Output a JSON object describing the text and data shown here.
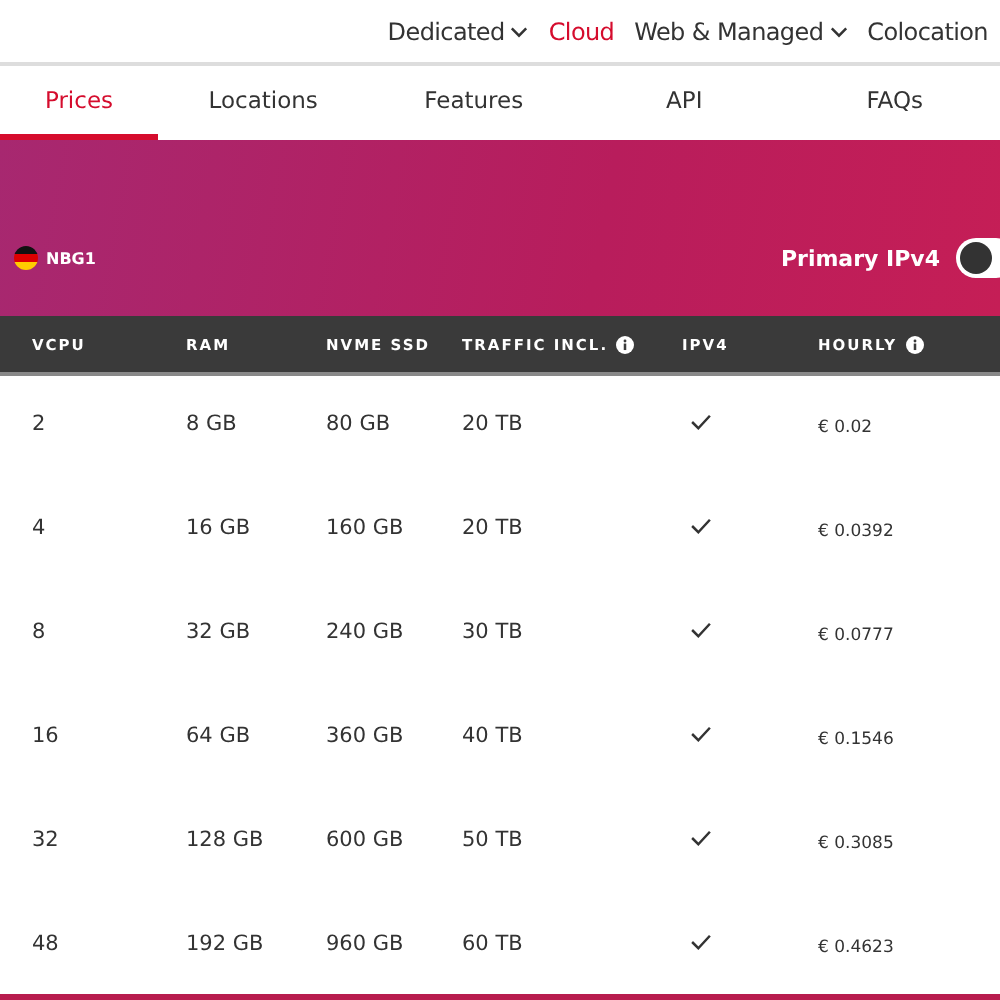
{
  "nav": [
    {
      "label": "Dedicated",
      "dropdown": true,
      "selected": false
    },
    {
      "label": "Cloud",
      "dropdown": false,
      "selected": true
    },
    {
      "label": "Web & Managed",
      "dropdown": true,
      "selected": false
    },
    {
      "label": "Colocation",
      "dropdown": false,
      "selected": false
    }
  ],
  "tabs": [
    {
      "label": "Prices",
      "selected": true
    },
    {
      "label": "Locations",
      "selected": false
    },
    {
      "label": "Features",
      "selected": false
    },
    {
      "label": "API",
      "selected": false
    },
    {
      "label": "FAQs",
      "selected": false
    }
  ],
  "location": {
    "label": "NBG1"
  },
  "ipv4_toggle": {
    "label": "Primary IPv4",
    "on": false
  },
  "table": {
    "columns": [
      {
        "label": "VCPU",
        "info": false
      },
      {
        "label": "RAM",
        "info": false
      },
      {
        "label": "NVME SSD",
        "info": false
      },
      {
        "label": "TRAFFIC INCL.",
        "info": true
      },
      {
        "label": "IPV4",
        "info": false
      },
      {
        "label": "HOURLY",
        "info": true
      }
    ],
    "rows": [
      {
        "vcpu": "2",
        "ram": "8 GB",
        "ssd": "80 GB",
        "traffic": "20 TB",
        "ipv4": true,
        "hourly": "€ 0.02"
      },
      {
        "vcpu": "4",
        "ram": "16 GB",
        "ssd": "160 GB",
        "traffic": "20 TB",
        "ipv4": true,
        "hourly": "€ 0.0392"
      },
      {
        "vcpu": "8",
        "ram": "32 GB",
        "ssd": "240 GB",
        "traffic": "30 TB",
        "ipv4": true,
        "hourly": "€ 0.0777"
      },
      {
        "vcpu": "16",
        "ram": "64 GB",
        "ssd": "360 GB",
        "traffic": "40 TB",
        "ipv4": true,
        "hourly": "€ 0.1546"
      },
      {
        "vcpu": "32",
        "ram": "128 GB",
        "ssd": "600 GB",
        "traffic": "50 TB",
        "ipv4": true,
        "hourly": "€ 0.3085"
      },
      {
        "vcpu": "48",
        "ram": "192 GB",
        "ssd": "960 GB",
        "traffic": "60 TB",
        "ipv4": true,
        "hourly": "€ 0.4623"
      }
    ]
  }
}
